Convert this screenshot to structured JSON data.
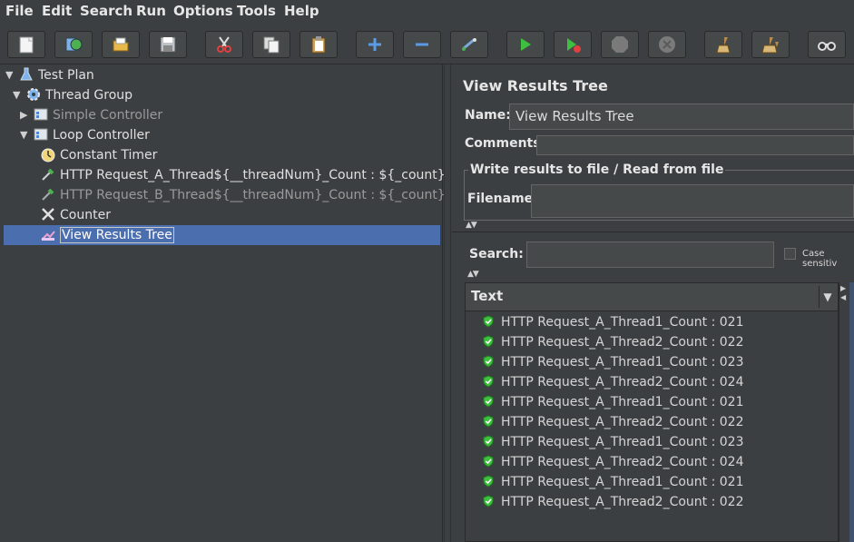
{
  "menu": {
    "file": "File",
    "edit": "Edit",
    "search": "Search",
    "run": "Run",
    "options": "Options",
    "tools": "Tools",
    "help": "Help"
  },
  "toolbar_icons": [
    "new-icon",
    "templates-icon",
    "open-icon",
    "save-icon",
    "cut-icon",
    "copy-icon",
    "paste-icon",
    "expand-icon",
    "collapse-icon",
    "toggle-icon",
    "start-icon",
    "start-no-pause-icon",
    "stop-icon",
    "shutdown-icon",
    "clear-icon",
    "clear-all-icon",
    "search-icon"
  ],
  "tree": {
    "test_plan": "Test Plan",
    "thread_group": "Thread Group",
    "simple_controller": "Simple Controller",
    "loop_controller": "Loop Controller",
    "constant_timer": "Constant Timer",
    "http_a": "HTTP Request_A_Thread${__threadNum}_Count : ${_count}",
    "http_b": "HTTP Request_B_Thread${__threadNum}_Count : ${_count}",
    "counter": "Counter",
    "view_results_tree": "View Results Tree"
  },
  "panel": {
    "title": "View Results Tree",
    "name_label": "Name:",
    "name_value": "View Results Tree",
    "comments_label": "Comments:",
    "write_group": "Write results to file / Read from file",
    "filename_label": "Filename",
    "search_label": "Search:",
    "case_sensitive": "Case sensitiv",
    "column_header": "Text"
  },
  "results": [
    "HTTP Request_A_Thread1_Count : 021",
    "HTTP Request_A_Thread2_Count : 022",
    "HTTP Request_A_Thread1_Count : 023",
    "HTTP Request_A_Thread2_Count : 024",
    "HTTP Request_A_Thread1_Count : 021",
    "HTTP Request_A_Thread2_Count : 022",
    "HTTP Request_A_Thread1_Count : 023",
    "HTTP Request_A_Thread2_Count : 024",
    "HTTP Request_A_Thread1_Count : 021",
    "HTTP Request_A_Thread2_Count : 022"
  ],
  "colors": {
    "background": "#3c3f41",
    "selection": "#4b6eaf",
    "success": "#3fbf3f"
  }
}
